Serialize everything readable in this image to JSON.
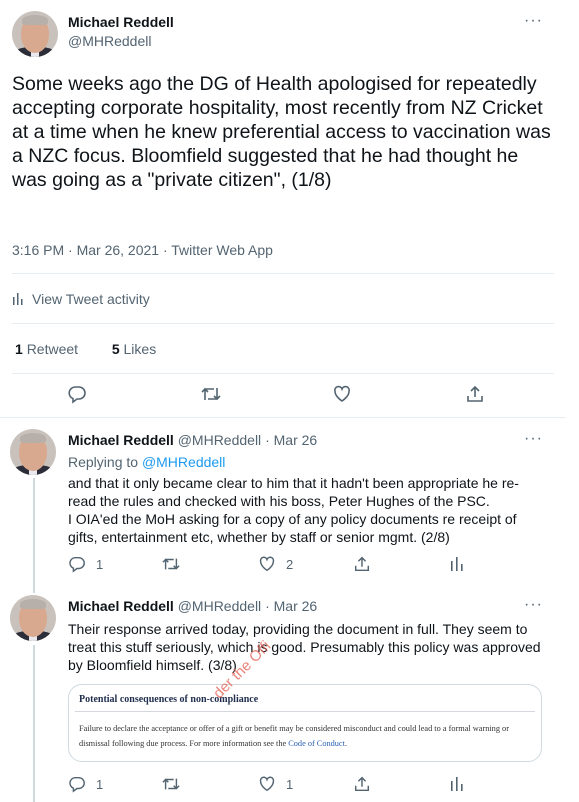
{
  "main_tweet": {
    "author_name": "Michael Reddell",
    "author_handle": "@MHReddell",
    "more_label": "···",
    "text": "Some weeks ago the DG of Health apologised for repeatedly accepting corporate hospitality, most recently from NZ Cricket at a time when he knew preferential access to vaccination was a NZC focus. Bloomfield suggested that he had thought he was going as a \"private citizen\", (1/8)",
    "timestamp": "3:16 PM · Mar 26, 2021 · Twitter Web App",
    "activity_label": "View Tweet activity",
    "retweet_count": "1",
    "retweet_label": "Retweet",
    "like_count": "5",
    "like_label": "Likes"
  },
  "replies": [
    {
      "author_name": "Michael Reddell",
      "author_handle": "@MHReddell",
      "time": "Mar 26",
      "replying_prefix": "Replying to ",
      "replying_to": "@MHReddell",
      "text": "and that it only became clear to him that it hadn't been appropriate he re-read the rules and checked with his boss, Peter Hughes of the PSC.\nI OIA'ed the MoH asking for a copy of any policy documents re receipt of gifts, entertainment etc, whether by staff or senior mgmt. (2/8)",
      "reply_count": "1",
      "retweet_count": "",
      "like_count": "2"
    },
    {
      "author_name": "Michael Reddell",
      "author_handle": "@MHReddell",
      "time": "Mar 26",
      "text": "Their response arrived today, providing the document in full.   They seem to treat this stuff seriously, which is good.  Presumably this policy was approved by Bloomfield himself.  (3/8)",
      "reply_count": "1",
      "retweet_count": "",
      "like_count": "1",
      "document": {
        "title": "Potential consequences of non-compliance",
        "body": "Failure to declare the acceptance or offer of a gift or benefit may be considered misconduct and could lead to a formal warning or dismissal following due process.  For more information see the ",
        "link": "Code of Conduct",
        "watermark": "der the Offi"
      }
    }
  ],
  "colors": {
    "text": "#0f1419",
    "secondary": "#536471",
    "link": "#1d9bf0",
    "border": "#e6ecf0"
  }
}
